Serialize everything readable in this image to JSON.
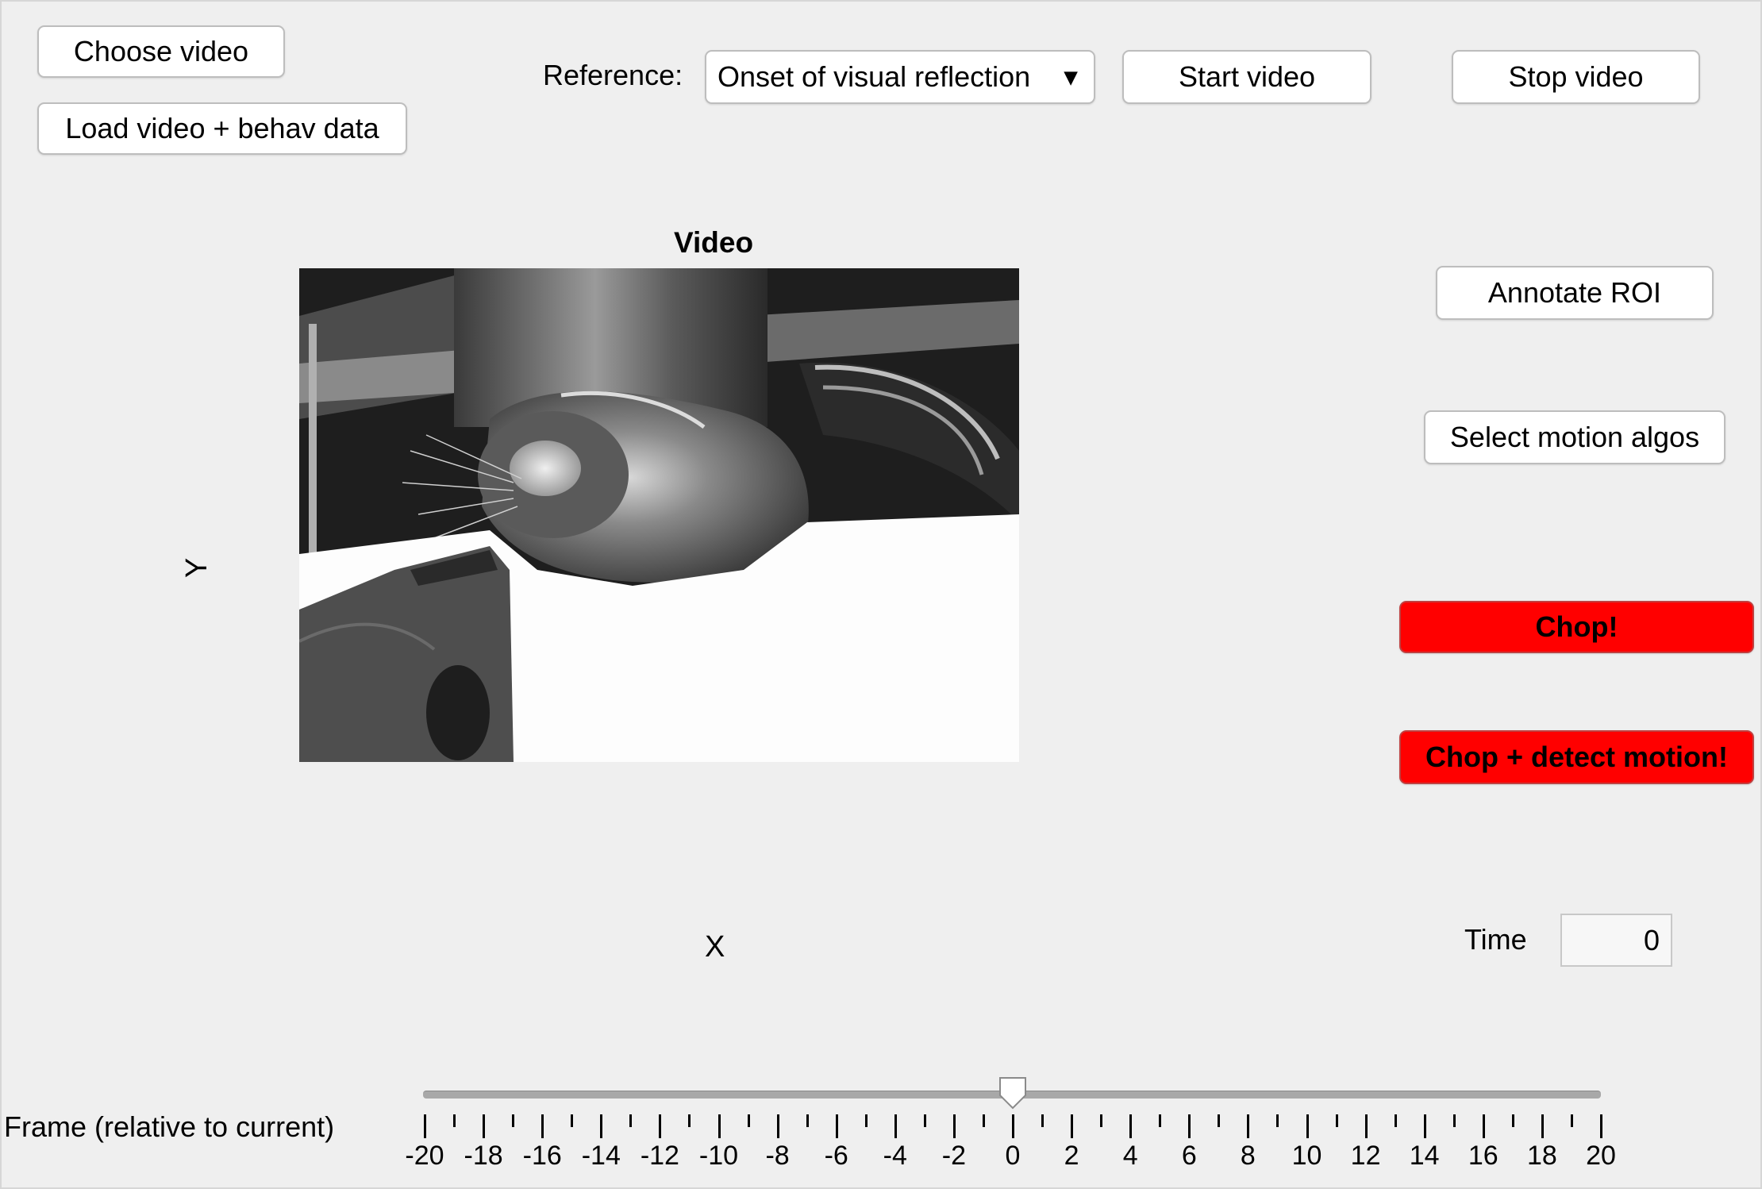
{
  "buttons": {
    "choose_video": "Choose video",
    "load_video": "Load video + behav data",
    "start_video": "Start video",
    "stop_video": "Stop video",
    "annotate_roi": "Annotate ROI",
    "select_motion": "Select motion algos",
    "chop": "Chop!",
    "chop_detect": "Chop + detect motion!"
  },
  "reference": {
    "label": "Reference:",
    "selected": "Onset of visual reflection",
    "arrow_icon": "triangle-down-icon"
  },
  "video": {
    "title": "Video",
    "xlabel": "X",
    "ylabel": "Y"
  },
  "time": {
    "label": "Time",
    "value": "0"
  },
  "frame_slider": {
    "label": "Frame (relative to current)",
    "value": 0,
    "min": -20,
    "max": 20,
    "tick_labels": [
      "-20",
      "-18",
      "-16",
      "-14",
      "-12",
      "-10",
      "-8",
      "-6",
      "-4",
      "-2",
      "0",
      "2",
      "4",
      "6",
      "8",
      "10",
      "12",
      "14",
      "16",
      "18",
      "20"
    ]
  },
  "colors": {
    "background": "#efefef",
    "chop_button": "#ff0000"
  }
}
